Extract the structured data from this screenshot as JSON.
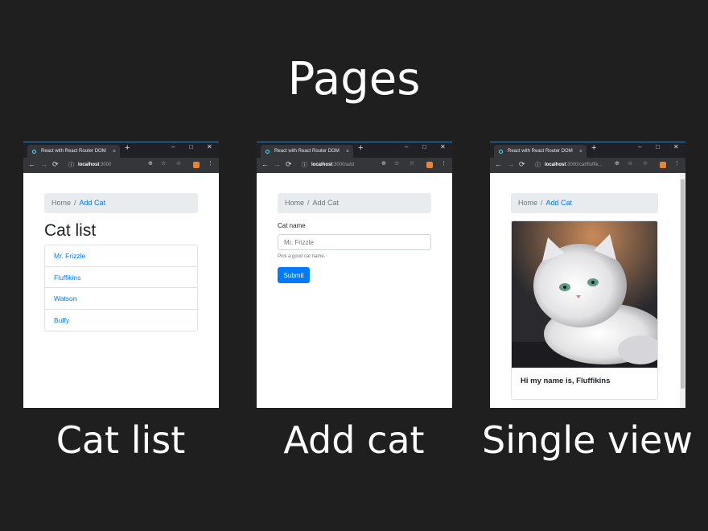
{
  "title": "Pages",
  "browser": {
    "tab_title": "React with React Router DOM",
    "tab_close": "×",
    "new_tab": "+",
    "window_controls": [
      "–",
      "□",
      "✕"
    ],
    "nav_icons": [
      "←",
      "→",
      "⟳",
      "ⓘ"
    ],
    "right_icons": [
      "⊕",
      "☆",
      "⊘",
      "⋮"
    ]
  },
  "panels": [
    {
      "caption": "Cat list",
      "url_host": "localhost",
      "url_path": ":3000",
      "breadcrumb": {
        "home": "Home",
        "separator": "/",
        "current": "Add Cat"
      },
      "heading": "Cat list",
      "cats": [
        "Mr. Frizzle",
        "Fluffikins",
        "Watson",
        "Buffy"
      ]
    },
    {
      "caption": "Add cat",
      "url_host": "localhost",
      "url_path": ":3000/add",
      "breadcrumb": {
        "home": "Home",
        "separator": "/",
        "current": "Add Cat"
      },
      "form": {
        "label": "Cat name",
        "placeholder": "Mr. Frizzle",
        "help": "Pick a good cat name.",
        "submit": "Submit"
      }
    },
    {
      "caption": "Single view",
      "url_host": "localhost",
      "url_path": ":3000/cat/fluffik...",
      "breadcrumb": {
        "home": "Home",
        "separator": "/",
        "current": "Add Cat"
      },
      "card_text": "Hi my name is, Fluffikins"
    }
  ],
  "colors": {
    "background": "#1f1f1f",
    "link": "#007bff",
    "button": "#007bff",
    "breadcrumb_bg": "#e9ecef"
  }
}
